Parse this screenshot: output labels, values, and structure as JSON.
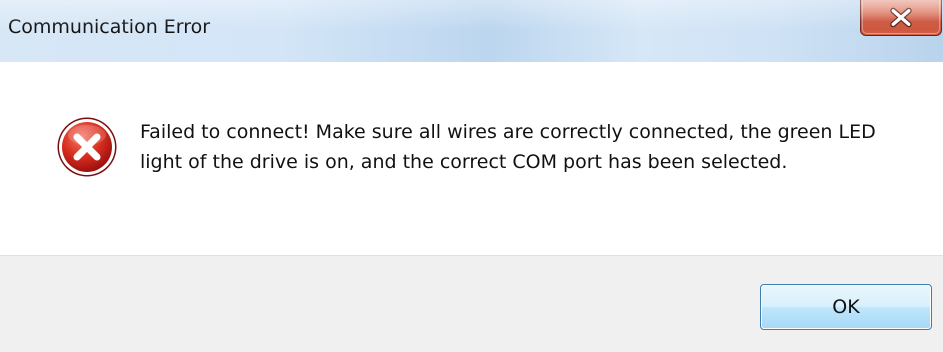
{
  "dialog": {
    "title": "Communication Error",
    "close_icon": "close-x-icon",
    "message_icon": "error-icon",
    "message": "Failed to connect! Make sure all wires are correctly connected, the green LED light of the drive is on, and the correct COM port has been selected.",
    "ok_label": "OK"
  },
  "colors": {
    "close_button": "#c84a30",
    "error_icon": "#c8201e",
    "ok_border": "#3c7fb1",
    "footer_bg": "#f0f0f0"
  }
}
